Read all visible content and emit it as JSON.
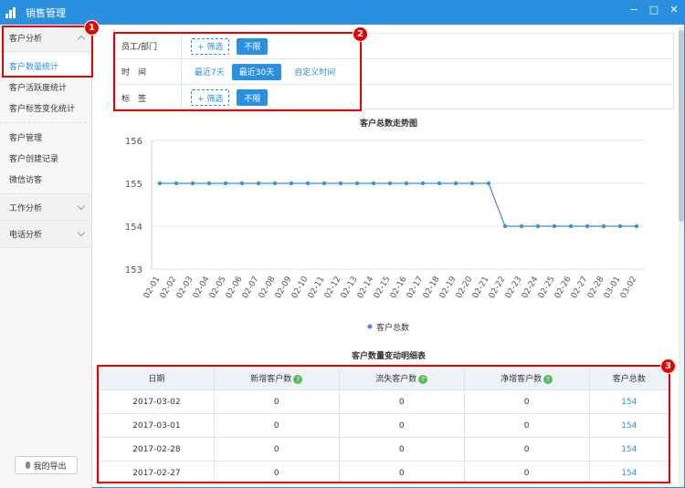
{
  "window": {
    "title": "销售管理"
  },
  "sidebar": {
    "groups": [
      {
        "label": "客户分析"
      },
      {
        "label": "工作分析"
      },
      {
        "label": "电话分析"
      }
    ],
    "analysis_items": [
      "客户数量统计",
      "客户活跃度统计",
      "客户标签变化统计"
    ],
    "manage_items": [
      "客户管理",
      "客户创建记录",
      "微信访客"
    ],
    "export_label": "我的导出"
  },
  "filters": {
    "employee": {
      "label": "员工/部门",
      "add": "+ 筛选",
      "selected": "不限"
    },
    "time": {
      "label": "时　间",
      "options": [
        "最近7天",
        "最近30天",
        "自定义时间"
      ]
    },
    "tag": {
      "label": "标　签",
      "add": "+ 筛选",
      "selected": "不限"
    }
  },
  "chart_data": {
    "type": "line",
    "title": "客户总数走势图",
    "categories": [
      "02-01",
      "02-02",
      "02-03",
      "02-04",
      "02-05",
      "02-06",
      "02-07",
      "02-08",
      "02-09",
      "02-10",
      "02-11",
      "02-12",
      "02-13",
      "02-14",
      "02-15",
      "02-16",
      "02-17",
      "02-18",
      "02-19",
      "02-20",
      "02-21",
      "02-22",
      "02-23",
      "02-24",
      "02-25",
      "02-26",
      "02-27",
      "02-28",
      "03-01",
      "03-02"
    ],
    "series": [
      {
        "name": "客户总数",
        "values": [
          155,
          155,
          155,
          155,
          155,
          155,
          155,
          155,
          155,
          155,
          155,
          155,
          155,
          155,
          155,
          155,
          155,
          155,
          155,
          155,
          155,
          154,
          154,
          154,
          154,
          154,
          154,
          154,
          154,
          154
        ]
      }
    ],
    "ylim": [
      153,
      156
    ],
    "yticks": [
      153,
      154,
      155,
      156
    ],
    "color": "#3d8fd9",
    "legend": "bottom",
    "grid": true
  },
  "table": {
    "title": "客户数量变动明细表",
    "headers": [
      "日期",
      "新增客户数",
      "流失客户数",
      "净增客户数",
      "客户总数"
    ],
    "rows": [
      [
        "2017-03-02",
        "0",
        "0",
        "0",
        "154"
      ],
      [
        "2017-03-01",
        "0",
        "0",
        "0",
        "154"
      ],
      [
        "2017-02-28",
        "0",
        "0",
        "0",
        "154"
      ],
      [
        "2017-02-27",
        "0",
        "0",
        "0",
        "154"
      ]
    ]
  },
  "badges": [
    "1",
    "2",
    "3"
  ],
  "window_controls": [
    "−",
    "□",
    "✕"
  ]
}
